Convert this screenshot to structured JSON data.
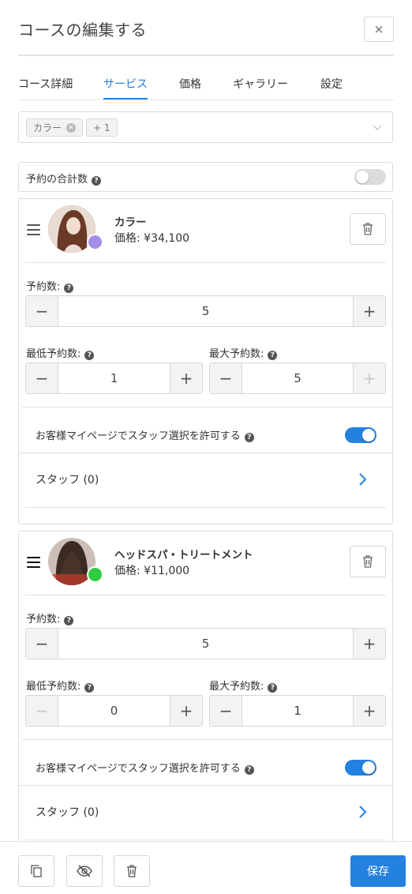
{
  "header": {
    "title": "コースの編集する",
    "close_label": "×"
  },
  "tabs": [
    {
      "label": "コース詳細",
      "active": false
    },
    {
      "label": "サービス",
      "active": true
    },
    {
      "label": "価格",
      "active": false
    },
    {
      "label": "ギャラリー",
      "active": false
    },
    {
      "label": "設定",
      "active": false
    }
  ],
  "service_select": {
    "chips": [
      {
        "label": "カラー",
        "removable": true
      },
      {
        "label": "+ 1",
        "removable": false
      }
    ],
    "remove_glyph": "×"
  },
  "total_bookings": {
    "label": "予約の合計数",
    "help": "?",
    "enabled": false
  },
  "services": [
    {
      "name": "カラー",
      "price": "価格: ¥34,100",
      "dot_color": "#a48ee8",
      "bookings_label": "予約数:",
      "bookings": "5",
      "min_label": "最低予約数:",
      "min": "1",
      "max_label": "最大予約数:",
      "max": "5",
      "staff_permission_label": "お客様マイページでスタッフ選択を許可する",
      "staff_permission": true,
      "staff_label": "スタッフ (0)"
    },
    {
      "name": "ヘッドスパ・トリートメント",
      "price": "価格: ¥11,000",
      "dot_color": "#2ecc40",
      "bookings_label": "予約数:",
      "bookings": "5",
      "min_label": "最低予約数:",
      "min": "0",
      "max_label": "最大予約数:",
      "max": "1",
      "staff_permission_label": "お客様マイページでスタッフ選択を許可する",
      "staff_permission": true,
      "staff_label": "スタッフ (0)"
    }
  ],
  "stepper_glyphs": {
    "minus": "−",
    "plus": "+"
  },
  "help_glyph": "?",
  "footer": {
    "save_label": "保存"
  },
  "colors": {
    "accent": "#2481e0",
    "border": "#dadada"
  }
}
